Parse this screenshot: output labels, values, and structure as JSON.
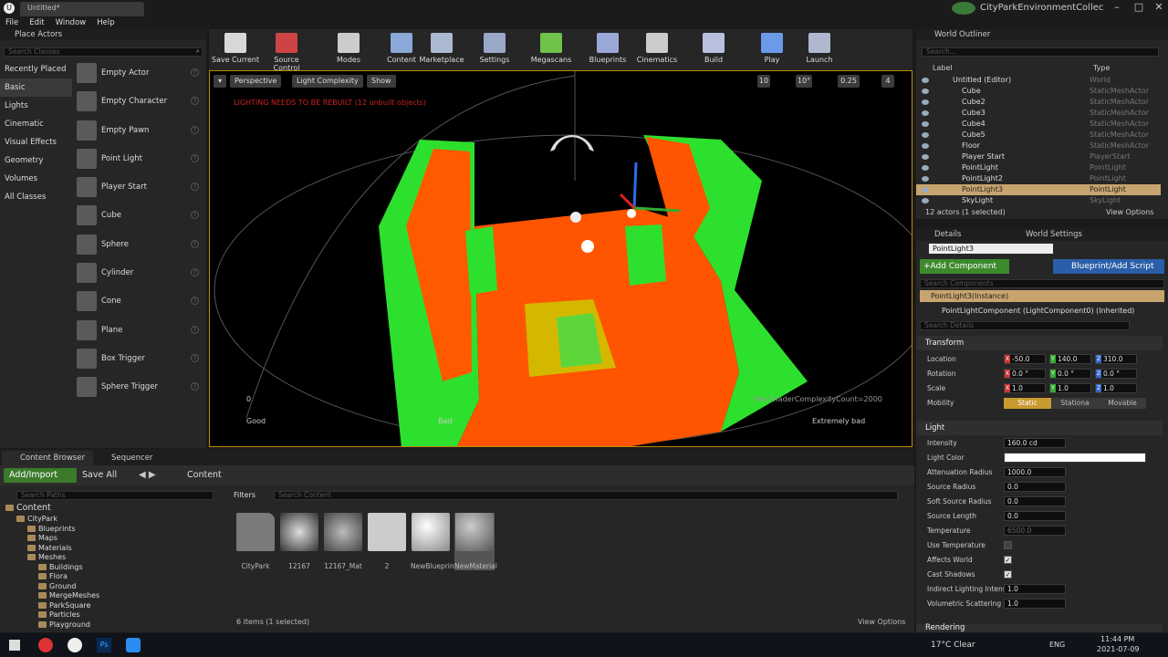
{
  "window": {
    "tab_title": "Untitled*",
    "project": "CityParkEnvironmentCollec"
  },
  "menu": [
    "File",
    "Edit",
    "Window",
    "Help"
  ],
  "place_actors": {
    "title": "Place Actors",
    "search_placeholder": "Search Classes",
    "categories": [
      "Recently Placed",
      "Basic",
      "Lights",
      "Cinematic",
      "Visual Effects",
      "Geometry",
      "Volumes",
      "All Classes"
    ],
    "selected_category": "Basic",
    "items": [
      "Empty Actor",
      "Empty Character",
      "Empty Pawn",
      "Point Light",
      "Player Start",
      "Cube",
      "Sphere",
      "Cylinder",
      "Cone",
      "Plane",
      "Box Trigger",
      "Sphere Trigger"
    ]
  },
  "toolbar": [
    {
      "label": "Save Current",
      "icon": "save-icon",
      "color": "#d8d8d8"
    },
    {
      "label": "Source Control",
      "icon": "source-control-icon",
      "color": "#c44"
    },
    {
      "label": "Modes",
      "icon": "modes-icon",
      "color": "#ccc"
    },
    {
      "label": "Content",
      "icon": "content-icon",
      "color": "#8aa8d8"
    },
    {
      "label": "Marketplace",
      "icon": "marketplace-icon",
      "color": "#aab8d0"
    },
    {
      "label": "Settings",
      "icon": "settings-icon",
      "color": "#9aa8c8"
    },
    {
      "label": "Megascans",
      "icon": "megascans-icon",
      "color": "#6fc24a"
    },
    {
      "label": "Blueprints",
      "icon": "blueprints-icon",
      "color": "#9aa8d8"
    },
    {
      "label": "Cinematics",
      "icon": "cinematics-icon",
      "color": "#ccc"
    },
    {
      "label": "Build",
      "icon": "build-icon",
      "color": "#b8c0e0"
    },
    {
      "label": "Play",
      "icon": "play-icon",
      "color": "#6a9ae8"
    },
    {
      "label": "Launch",
      "icon": "launch-icon",
      "color": "#b0b8d0"
    }
  ],
  "viewport": {
    "perspective": "Perspective",
    "view_mode": "Light Complexity",
    "show": "Show",
    "warning": "LIGHTING NEEDS TO BE REBUILT (12 unbuilt objects)",
    "snap_grid": "10",
    "snap_rot": "10°",
    "snap_scale": "0.25",
    "cam_speed": "4",
    "legend_zero": "0",
    "legend_good": "Good",
    "legend_bad": "Bad",
    "legend_extreme": "Extremely bad",
    "max_label": "MaxShaderComplexityCount=2000",
    "colors": {
      "good": "#22dd22",
      "bad": "#ff5500",
      "mid": "#d4b800"
    }
  },
  "content_browser": {
    "tab": "Content Browser",
    "tab2": "Sequencer",
    "add_import": "Add/Import",
    "save_all": "Save All",
    "path": "Content",
    "search_paths": "Search Paths",
    "filters": "Filters",
    "search_content": "Search Content",
    "tree": [
      {
        "label": "Content",
        "depth": 0
      },
      {
        "label": "CityPark",
        "depth": 1
      },
      {
        "label": "Blueprints",
        "depth": 2
      },
      {
        "label": "Maps",
        "depth": 2
      },
      {
        "label": "Materials",
        "depth": 2
      },
      {
        "label": "Meshes",
        "depth": 2
      },
      {
        "label": "Buildings",
        "depth": 3
      },
      {
        "label": "Flora",
        "depth": 3
      },
      {
        "label": "Ground",
        "depth": 3
      },
      {
        "label": "MergeMeshes",
        "depth": 3
      },
      {
        "label": "ParkSquare",
        "depth": 3
      },
      {
        "label": "Particles",
        "depth": 3
      },
      {
        "label": "Playground",
        "depth": 3
      }
    ],
    "assets": [
      "CityPark",
      "12167",
      "12167_Mat",
      "2",
      "NewBlueprint",
      "NewMaterial"
    ],
    "status": "6 items (1 selected)",
    "view_options": "View Options"
  },
  "outliner": {
    "title": "World Outliner",
    "search_placeholder": "Search...",
    "col_label": "Label",
    "col_type": "Type",
    "rows": [
      {
        "label": "Untitled (Editor)",
        "type": "World"
      },
      {
        "label": "Cube",
        "type": "StaticMeshActor"
      },
      {
        "label": "Cube2",
        "type": "StaticMeshActor"
      },
      {
        "label": "Cube3",
        "type": "StaticMeshActor"
      },
      {
        "label": "Cube4",
        "type": "StaticMeshActor"
      },
      {
        "label": "Cube5",
        "type": "StaticMeshActor"
      },
      {
        "label": "Floor",
        "type": "StaticMeshActor"
      },
      {
        "label": "Player Start",
        "type": "PlayerStart"
      },
      {
        "label": "PointLight",
        "type": "PointLight"
      },
      {
        "label": "PointLight2",
        "type": "PointLight"
      },
      {
        "label": "PointLight3",
        "type": "PointLight"
      },
      {
        "label": "SkyLight",
        "type": "SkyLight"
      }
    ],
    "selected": "PointLight3",
    "status": "12 actors (1 selected)",
    "view_options": "View Options"
  },
  "details": {
    "tab": "Details",
    "tab2": "World Settings",
    "name": "PointLight3",
    "add_component": "+Add Component",
    "blueprint_script": "Blueprint/Add Script",
    "search_components": "Search Components",
    "instance": "PointLight3(Instance)",
    "component": "PointLightComponent (LightComponent0) (Inherited)",
    "search_details": "Search Details",
    "transform": "Transform",
    "location_label": "Location",
    "location": [
      "-50.0",
      "140.0",
      "310.0"
    ],
    "rotation_label": "Rotation",
    "rotation": [
      "0.0 °",
      "0.0 °",
      "0.0 °"
    ],
    "scale_label": "Scale",
    "scale": [
      "1.0",
      "1.0",
      "1.0"
    ],
    "mobility_label": "Mobility",
    "mobility": [
      "Static",
      "Stationa",
      "Movable"
    ],
    "light": "Light",
    "props": [
      {
        "label": "Intensity",
        "value": "160.0 cd"
      },
      {
        "label": "Light Color",
        "value": ""
      },
      {
        "label": "Attenuation Radius",
        "value": "1000.0"
      },
      {
        "label": "Source Radius",
        "value": "0.0"
      },
      {
        "label": "Soft Source Radius",
        "value": "0.0"
      },
      {
        "label": "Source Length",
        "value": "0.0"
      },
      {
        "label": "Temperature",
        "value": "6500.0"
      },
      {
        "label": "Use Temperature",
        "value": "off"
      },
      {
        "label": "Affects World",
        "value": "on"
      },
      {
        "label": "Cast Shadows",
        "value": "on"
      },
      {
        "label": "Indirect Lighting Intensit",
        "value": "1.0"
      },
      {
        "label": "Volumetric Scattering In",
        "value": "1.0"
      }
    ],
    "rendering": "Rendering"
  },
  "taskbar": {
    "weather": "17°C  Clear",
    "lang": "ENG",
    "time": "11:44 PM",
    "date": "2021-07-09"
  }
}
